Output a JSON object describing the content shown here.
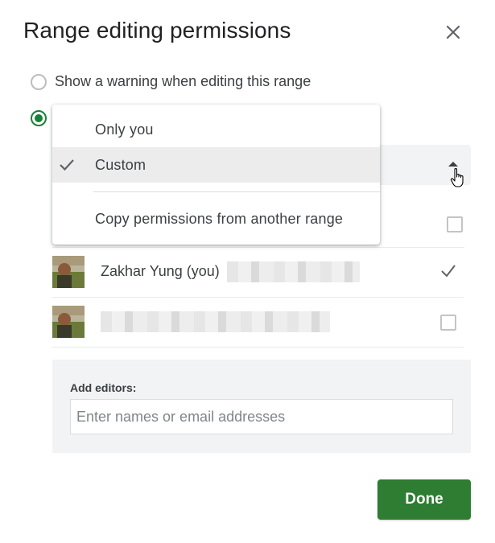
{
  "dialog": {
    "title": "Range editing permissions"
  },
  "options": {
    "warning_label": "Show a warning when editing this range"
  },
  "menu": {
    "items": [
      {
        "label": "Only you"
      },
      {
        "label": "Custom"
      },
      {
        "label": "Copy permissions from another range"
      }
    ],
    "selected": "Custom"
  },
  "users": [
    {
      "name": "Zakhar Yung (you)",
      "checked": true
    },
    {
      "name": "",
      "checked": false
    }
  ],
  "editors": {
    "label": "Add editors:",
    "placeholder": "Enter names or email addresses"
  },
  "buttons": {
    "done": "Done"
  },
  "colors": {
    "accent_green": "#2e7d32",
    "radio_green": "#188038"
  },
  "icons": [
    "close-icon",
    "check-icon",
    "arrow-up-icon",
    "hand-cursor-icon"
  ]
}
